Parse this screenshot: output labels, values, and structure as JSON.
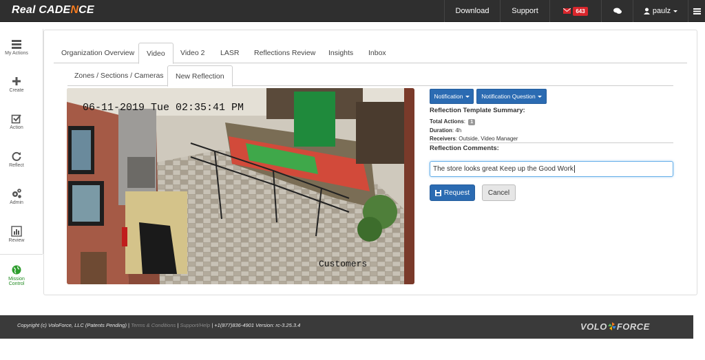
{
  "brand": {
    "prefix": "Real ",
    "mid": "CADE",
    "n": "N",
    "c": "C",
    "e": "E"
  },
  "topnav": {
    "download": "Download",
    "support": "Support",
    "mail_count": "643",
    "user": "paulz"
  },
  "sidebar": {
    "items": [
      {
        "label": "My Actions"
      },
      {
        "label": "Create"
      },
      {
        "label": "Action"
      },
      {
        "label": "Reflect"
      },
      {
        "label": "Admin"
      },
      {
        "label": "Review"
      },
      {
        "label": "Mission Control"
      }
    ]
  },
  "tabs": [
    "Organization Overview",
    "Video",
    "Video 2",
    "LASR",
    "Reflections Review",
    "Insights",
    "Inbox"
  ],
  "subtabs": [
    "Zones / Sections / Cameras",
    "New Reflection"
  ],
  "camera": {
    "timestamp": "06-11-2019 Tue 02:35:41 PM",
    "label": "Customers"
  },
  "form": {
    "notification_btn": "Notification",
    "notification_question_btn": "Notification Question",
    "summary_title": "Reflection Template Summary:",
    "total_actions_label": "Total Actions",
    "total_actions_value": "1",
    "duration_label": "Duration",
    "duration_value": "4h",
    "receivers_label": "Receivers",
    "receivers_value": "Outside, Video Manager",
    "comments_title": "Reflection Comments:",
    "comment_value": "The store looks great Keep up the Good Work",
    "request_btn": "Request",
    "cancel_btn": "Cancel"
  },
  "footer": {
    "copyright": "Copyright (c) VoloForce, LLC (Patents Pending) | ",
    "terms": "Terms & Conditions",
    "sep": " | ",
    "support": "Support/Help",
    "rest": " | +1(877)836-4901 Version: rc-3.25.3.4",
    "logo_left": "VOLO",
    "logo_right": "FORCE"
  }
}
